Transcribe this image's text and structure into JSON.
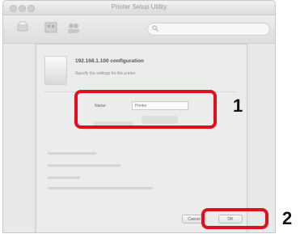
{
  "window": {
    "title": "Printer Setup Utility"
  },
  "sheet": {
    "title": "192.168.1.100 configuration",
    "description": "Specify the settings for the printer"
  },
  "field": {
    "label": "Name:",
    "value": "Printer"
  },
  "buttons": {
    "cancel": "Cancel",
    "ok": "OK"
  },
  "callouts": {
    "one": "1",
    "two": "2"
  },
  "colors": {
    "highlight": "#e10e1c"
  }
}
